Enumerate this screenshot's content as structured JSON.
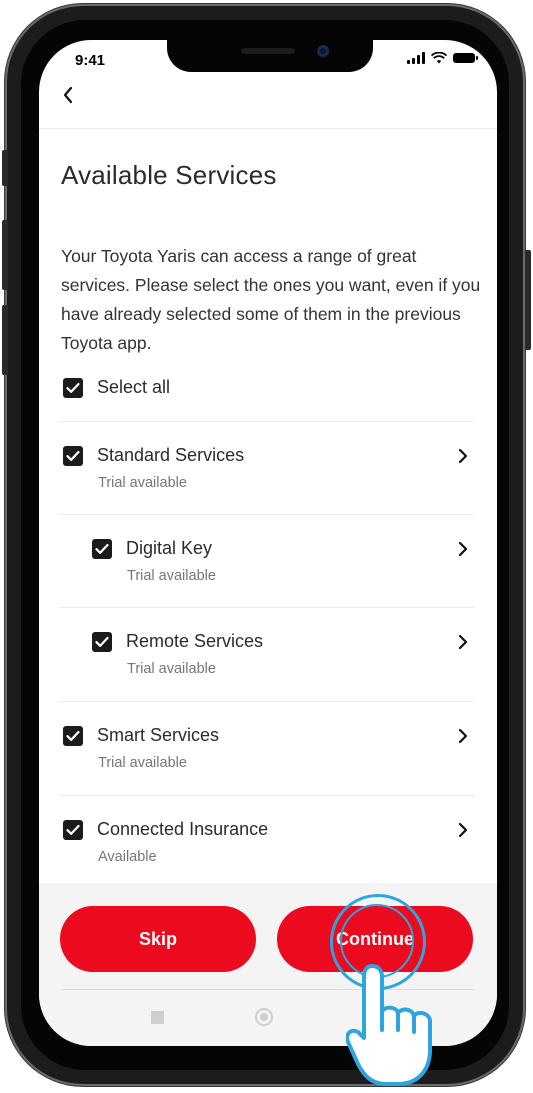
{
  "status_bar": {
    "time": "9:41"
  },
  "page": {
    "title": "Available Services",
    "intro": "Your Toyota Yaris can access a range of great services. Please select the ones you want, even if you have already selected some of them in the previous Toyota app."
  },
  "select_all": {
    "label": "Select all",
    "checked": true
  },
  "services": [
    {
      "label": "Standard Services",
      "status": "Trial available",
      "checked": true,
      "indent": 0
    },
    {
      "label": "Digital Key",
      "status": "Trial available",
      "checked": true,
      "indent": 1
    },
    {
      "label": "Remote Services",
      "status": "Trial available",
      "checked": true,
      "indent": 1
    },
    {
      "label": "Smart Services",
      "status": "Trial available",
      "checked": true,
      "indent": 0
    },
    {
      "label": "Connected Insurance",
      "status": "Available",
      "checked": true,
      "indent": 0
    }
  ],
  "actions": {
    "skip": "Skip",
    "continue": "Continue"
  },
  "colors": {
    "brand_red": "#eb0a1e",
    "checkbox": "#1b1b1b",
    "tap_indicator": "#2ea6dd"
  },
  "icons": [
    "back-chevron-icon",
    "chevron-right-icon",
    "checkmark-icon",
    "signal-icon",
    "wifi-icon",
    "battery-icon",
    "tap-hand-icon"
  ]
}
